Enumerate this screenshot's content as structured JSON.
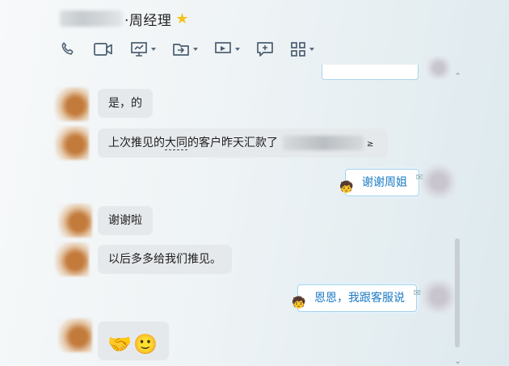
{
  "header": {
    "title": "·周经理",
    "star": "★",
    "toolbar": [
      {
        "name": "phone-icon"
      },
      {
        "name": "video-icon"
      },
      {
        "name": "screen-share-icon"
      },
      {
        "name": "file-transfer-icon"
      },
      {
        "name": "remote-desktop-icon"
      },
      {
        "name": "add-chat-icon"
      },
      {
        "name": "apps-icon"
      }
    ]
  },
  "messages": [
    {
      "side": "left",
      "text": "是，的"
    },
    {
      "side": "left",
      "text_before": "上次推见的",
      "text_underlined": "大同",
      "text_after": "的客户昨天汇款了",
      "trailing": "≥"
    },
    {
      "side": "right",
      "text": "谢谢周姐"
    },
    {
      "side": "left",
      "text": "谢谢啦"
    },
    {
      "side": "left",
      "text": "以后多多给我们推见。"
    },
    {
      "side": "right",
      "text": "恩恩，我跟客服说"
    },
    {
      "side": "left",
      "emojis": [
        "🤝",
        "🙂"
      ]
    }
  ],
  "colors": {
    "accent_blue": "#1a7ac4",
    "bubble_gray": "#e6e9ec",
    "star": "#f2c21b"
  }
}
